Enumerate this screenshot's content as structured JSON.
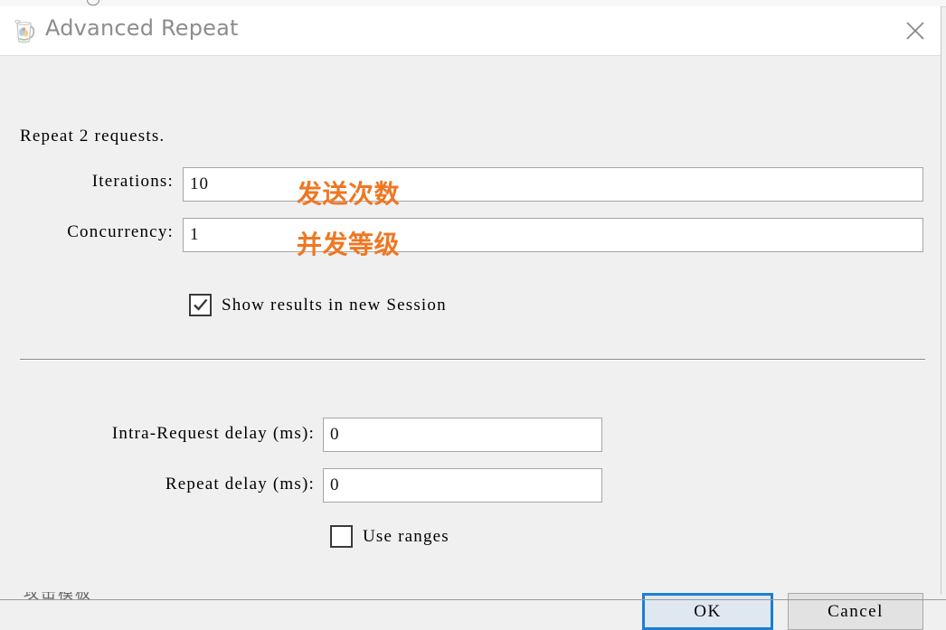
{
  "window": {
    "title": "Advanced Repeat",
    "icon": "burp-pitcher-icon",
    "close_label": "✕"
  },
  "form": {
    "summary": "Repeat 2 requests.",
    "iterations": {
      "label": "Iterations:",
      "value": "10",
      "annotation": "发送次数"
    },
    "concurrency": {
      "label": "Concurrency:",
      "value": "1",
      "annotation": "并发等级"
    },
    "show_results": {
      "label": "Show results in new Session",
      "checked": true
    },
    "intra_request_delay": {
      "label": "Intra-Request delay (ms):",
      "value": "0"
    },
    "repeat_delay": {
      "label": "Repeat delay (ms):",
      "value": "0"
    },
    "use_ranges": {
      "label": "Use ranges",
      "checked": false
    }
  },
  "buttons": {
    "ok": "OK",
    "cancel": "Cancel"
  },
  "colors": {
    "annotation_orange": "#ee7722",
    "focus_blue": "#1a7fd4",
    "ok_fill": "#dfe7f0",
    "dialog_bg": "#f0f0f0",
    "title_text": "#8d8d8d"
  },
  "bottom_clipped_text": "攻击模板"
}
